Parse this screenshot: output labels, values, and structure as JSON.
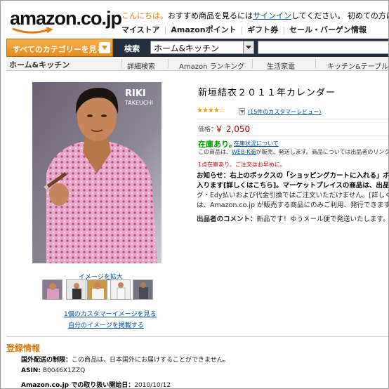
{
  "header": {
    "logo_text": "amazon.co.jp",
    "greeting_hello": "こんにちは。",
    "greeting_pre": "おすすめ商品を見るには",
    "signin": "サインイン",
    "greeting_post": "してください。 初めての方はこちら",
    "links": [
      "マイストア",
      "Amazonポイント",
      "ギフト券",
      "セール・バーゲン情報"
    ]
  },
  "search": {
    "category_button": "すべてのカテゴリーを見る",
    "label": "検索",
    "selected": "ホーム&キッチン",
    "query": ""
  },
  "subnav": {
    "store": "ホーム&キッチン",
    "items": [
      "詳細検索",
      "Amazon ランキング",
      "生活家電",
      "キッチン&テーブル"
    ]
  },
  "gallery": {
    "enlarge": "イメージを拡大",
    "customer_images": "1個のカスタマーイメージを見る",
    "upload": "自分のイメージを掲載する"
  },
  "product": {
    "title": "新垣結衣２０１１年カレンダー",
    "reviews": "(15件のカスタマーレビュー)",
    "price_label": "価格：",
    "price": "￥ 2,050",
    "in_stock": "在庫あり。",
    "stock_link": "在庫状況について",
    "ship_pre": "この商品は、",
    "vendor": "WEB-K商",
    "ship_post": "が販売、発送します。商品については出品者のリンクからご確認ください。",
    "bulk": "1点在庫あり。ご注文はお早めに。",
    "notice_lines": [
      "お知らせ：右上のボックスの「ショッピングカートに入れる」ボタン",
      "入ります[詳しくはこちら]。マーケットプレイスの商品は、出品者に",
      "グ・Edy払いおよび代金引換ではご注文いただけません。[詳しくは",
      "は、Amazon.co.jp が販売する商品にのみご利用、発行できます。"
    ],
    "seller_label": "出品者のコメント：",
    "seller_comment": "新品です！ゆうメール便で発送いたします。土・日"
  },
  "details": {
    "heading": "登録情報",
    "rows": [
      {
        "label": "国外配送の制限：",
        "value": "この商品は、日本国外にお届けすることができません。"
      },
      {
        "label": "ASIN:",
        "value": "B0046X1ZZQ"
      },
      {
        "label": "Amazon.co.jp での取り扱い開始日：",
        "value": "2010/10/12"
      }
    ]
  },
  "colors": {
    "accent_orange": "#e47911",
    "link_blue": "#004b91",
    "price_red": "#990000",
    "stock_green": "#009900",
    "nav_dark": "#232f3e"
  }
}
